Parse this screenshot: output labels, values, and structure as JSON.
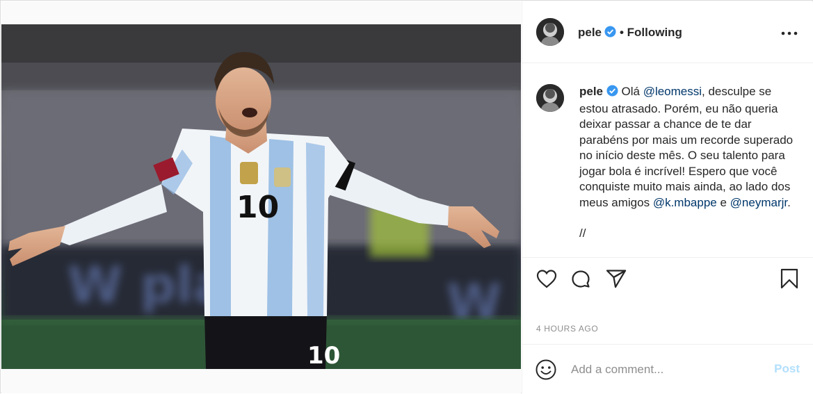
{
  "post": {
    "author": {
      "username": "pele",
      "verified": true,
      "follow_status": "Following"
    },
    "caption": {
      "username": "pele",
      "segments": [
        {
          "text": "Olá ",
          "mention": false
        },
        {
          "text": "@leomessi",
          "mention": true
        },
        {
          "text": ", desculpe se estou atrasado. Porém, eu não queria deixar passar a chance de te dar parabéns por mais um recorde superado no início deste mês. O seu talento para jogar bola é incrível! Espero que você conquiste muito mais ainda, ao lado dos meus amigos ",
          "mention": false
        },
        {
          "text": "@k.mbappe",
          "mention": true
        },
        {
          "text": " e ",
          "mention": false
        },
        {
          "text": "@neymarjr",
          "mention": true
        },
        {
          "text": ".",
          "mention": false
        }
      ],
      "continuation": "//"
    },
    "jersey_number": "10",
    "timestamp": "4 HOURS AGO",
    "comment_box": {
      "placeholder": "Add a comment...",
      "post_label": "Post"
    }
  },
  "icons": {
    "more": "more-options-icon",
    "like": "heart-icon",
    "comment": "comment-bubble-icon",
    "share": "paper-plane-icon",
    "save": "bookmark-icon",
    "emoji": "smiley-icon",
    "verified": "verified-badge-icon"
  },
  "colors": {
    "verified_blue": "#3897f0",
    "mention": "#00376b",
    "muted": "#8e8e8e",
    "post_disabled": "#b2dffc"
  }
}
